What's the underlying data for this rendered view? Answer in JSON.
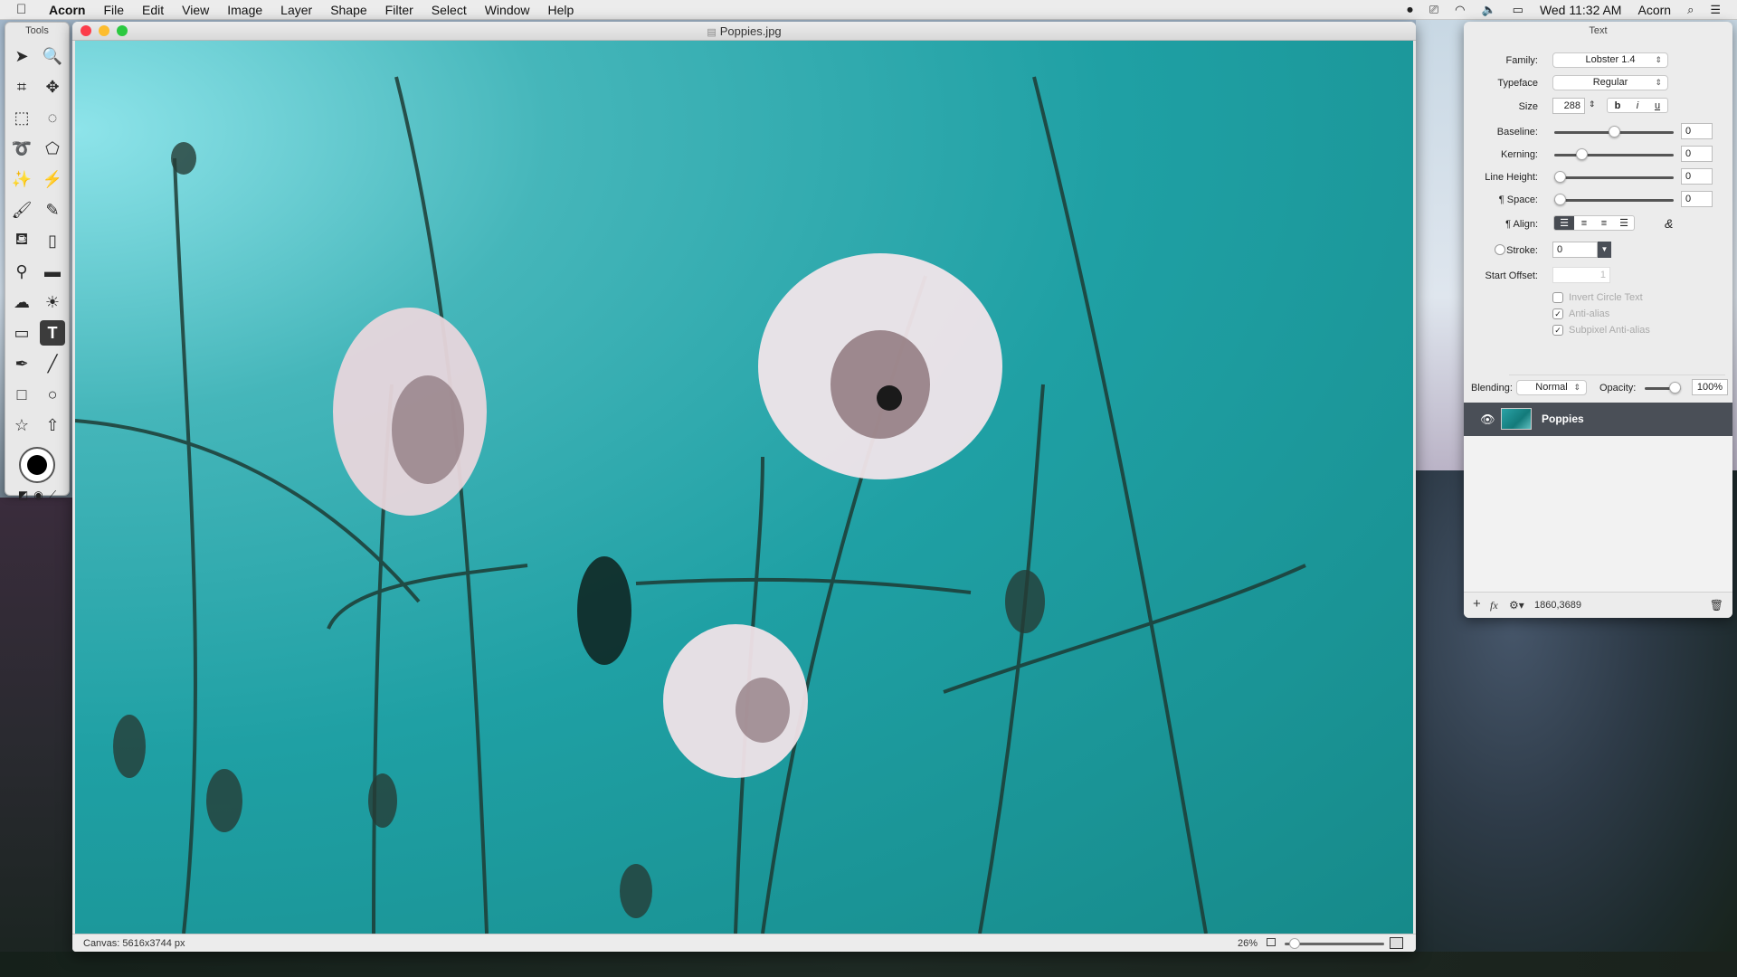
{
  "menubar": {
    "app_name": "Acorn",
    "items": [
      "File",
      "Edit",
      "View",
      "Image",
      "Layer",
      "Shape",
      "Filter",
      "Select",
      "Window",
      "Help"
    ],
    "status": {
      "icons": [
        "screen-record-icon",
        "airplay-icon",
        "wifi-icon",
        "volume-icon",
        "battery-icon"
      ],
      "clock": "Wed 11:32 AM",
      "user": "Acorn"
    }
  },
  "tools": {
    "title": "Tools",
    "items": [
      {
        "name": "select-arrow",
        "glyph": "➤"
      },
      {
        "name": "zoom",
        "glyph": "🔍"
      },
      {
        "name": "crop",
        "glyph": "⌗"
      },
      {
        "name": "move",
        "glyph": "✥"
      },
      {
        "name": "rect-marquee",
        "glyph": "⬚"
      },
      {
        "name": "ellipse-marquee",
        "glyph": "◌"
      },
      {
        "name": "lasso",
        "glyph": "➰"
      },
      {
        "name": "polygon-lasso",
        "glyph": "⬠"
      },
      {
        "name": "magic-wand",
        "glyph": "✨"
      },
      {
        "name": "quick-select",
        "glyph": "⚡"
      },
      {
        "name": "brush",
        "glyph": "🖌"
      },
      {
        "name": "pencil",
        "glyph": "✎"
      },
      {
        "name": "paint-bucket",
        "glyph": "⛾"
      },
      {
        "name": "eraser",
        "glyph": "▯"
      },
      {
        "name": "clone-stamp",
        "glyph": "⚲"
      },
      {
        "name": "smudge",
        "glyph": "▬"
      },
      {
        "name": "burn",
        "glyph": "☁"
      },
      {
        "name": "dodge",
        "glyph": "☀"
      },
      {
        "name": "gradient",
        "glyph": "▭"
      },
      {
        "name": "text",
        "glyph": "T",
        "active": true
      },
      {
        "name": "pen",
        "glyph": "✒"
      },
      {
        "name": "line",
        "glyph": "╱"
      },
      {
        "name": "rectangle",
        "glyph": "□"
      },
      {
        "name": "oval",
        "glyph": "○"
      },
      {
        "name": "star",
        "glyph": "☆"
      },
      {
        "name": "arrow-shape",
        "glyph": "⇧"
      }
    ],
    "bottom": [
      "◩",
      "◉",
      "⟋"
    ]
  },
  "document": {
    "title": "Poppies.jpg",
    "canvas_size": "Canvas: 5616x3744 px",
    "zoom": "26%",
    "zoom_fraction": 0.05
  },
  "inspector": {
    "title": "Text",
    "family_label": "Family:",
    "family_value": "Lobster 1.4",
    "typeface_label": "Typeface",
    "typeface_value": "Regular",
    "size_label": "Size",
    "size_value": "288",
    "style_buttons": [
      "b",
      "i",
      "u"
    ],
    "baseline_label": "Baseline:",
    "baseline_value": "0",
    "baseline_pos": 0.5,
    "kerning_label": "Kerning:",
    "kerning_value": "0",
    "kerning_pos": 0.2,
    "line_height_label": "Line Height:",
    "line_height_value": "0",
    "line_height_pos": 0.0,
    "space_label": "¶ Space:",
    "space_value": "0",
    "space_pos": 0.0,
    "align_label": "¶ Align:",
    "align_options": [
      "left",
      "center",
      "right",
      "justify"
    ],
    "align_selected": "left",
    "ligature_glyph": "&",
    "stroke_label": "Stroke:",
    "stroke_value": "0",
    "start_offset_label": "Start Offset:",
    "start_offset_value": "1",
    "checkboxes": [
      {
        "label": "Invert Circle Text",
        "checked": false
      },
      {
        "label": "Anti-alias",
        "checked": true
      },
      {
        "label": "Subpixel Anti-alias",
        "checked": true
      }
    ],
    "blending_label": "Blending:",
    "blending_value": "Normal",
    "opacity_label": "Opacity:",
    "opacity_value": "100%",
    "opacity_fraction": 1.0,
    "layers": [
      {
        "name": "Poppies",
        "visible": true
      }
    ],
    "footer_coords": "1860,3689"
  }
}
